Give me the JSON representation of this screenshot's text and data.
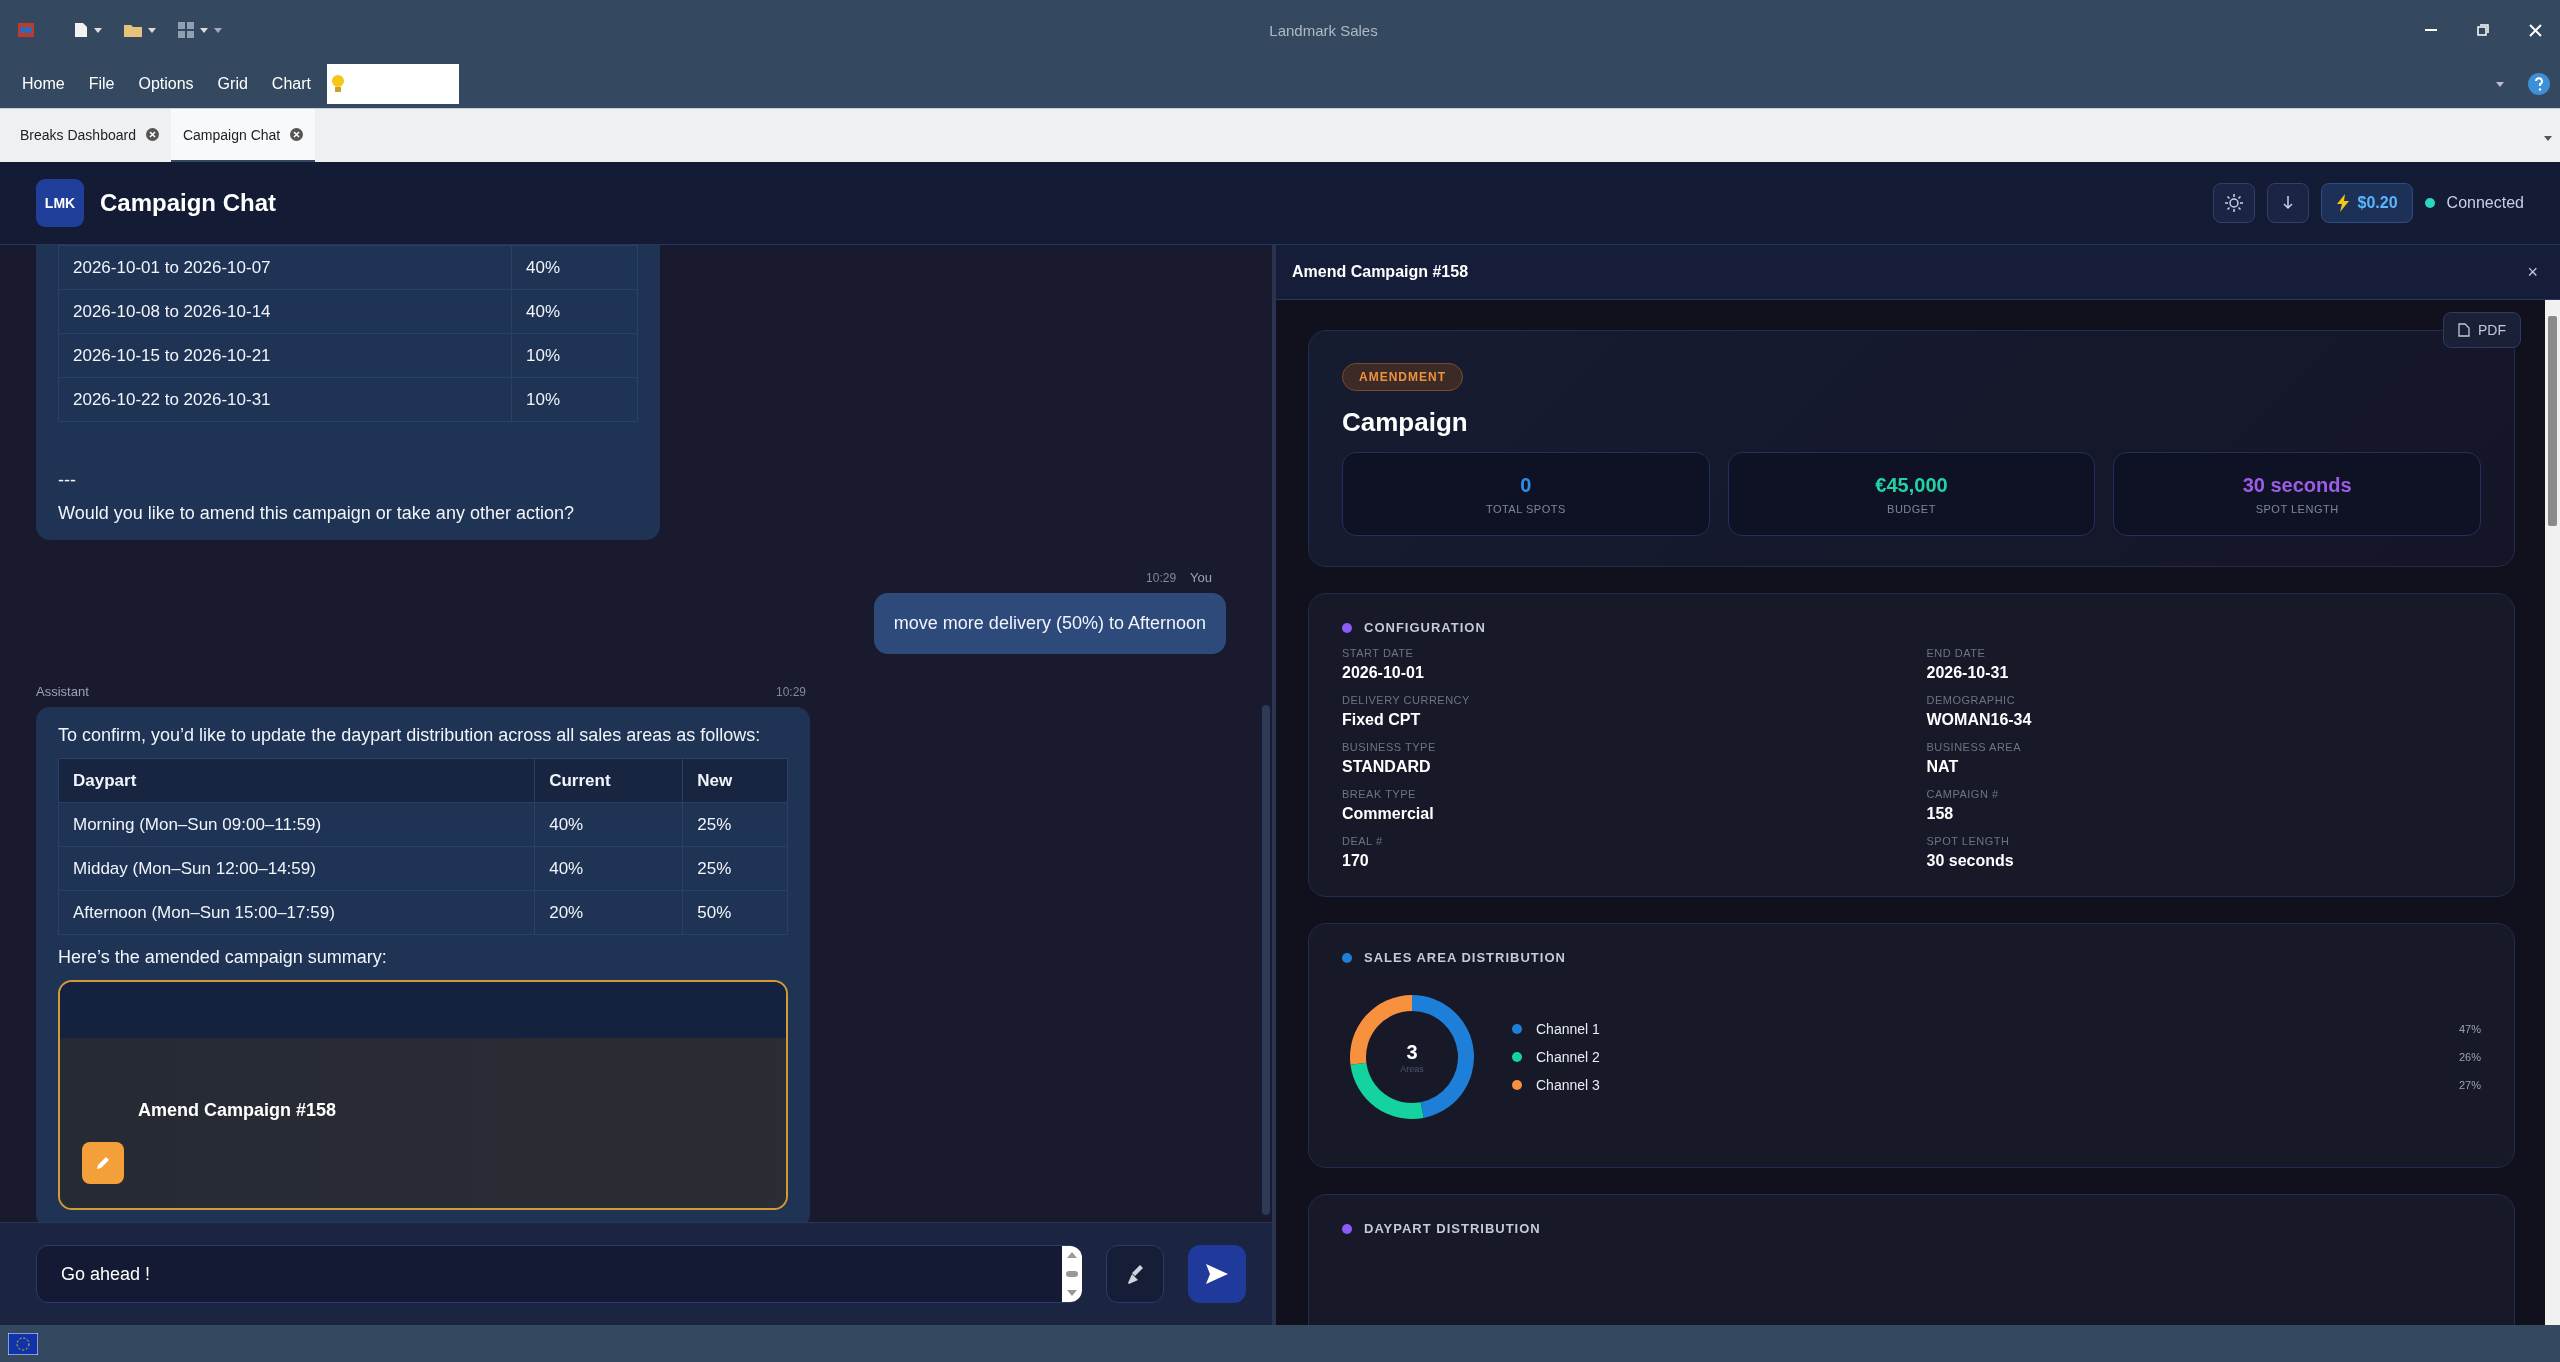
{
  "window": {
    "title": "Landmark Sales"
  },
  "menu": [
    "Home",
    "File",
    "Options",
    "Grid",
    "Chart"
  ],
  "doc_tabs": [
    {
      "label": "Breaks Dashboard",
      "selected": false
    },
    {
      "label": "Campaign Chat",
      "selected": true
    }
  ],
  "header": {
    "logo": "LMK",
    "title": "Campaign Chat",
    "cost": "$0.20",
    "status": "Connected"
  },
  "chat": {
    "messages": [
      {
        "kind": "assistant",
        "blocks": [
          {
            "kind": "table",
            "rows": [
              [
                "2026-10-01 to 2026-10-07",
                "40%"
              ],
              [
                "2026-10-08 to 2026-10-14",
                "40%"
              ],
              [
                "2026-10-15 to 2026-10-21",
                "10%"
              ],
              [
                "2026-10-22 to 2026-10-31",
                "10%"
              ]
            ]
          },
          {
            "kind": "text",
            "text": "---"
          },
          {
            "kind": "text",
            "text": "Would you like to amend this campaign or take any other action?"
          }
        ]
      },
      {
        "kind": "user",
        "time": "10:29",
        "sender": "You",
        "blocks": [
          {
            "kind": "text",
            "text": "move more delivery (50%) to Afternoon"
          }
        ]
      },
      {
        "kind": "assistant",
        "sender": "Assistant",
        "time": "10:29",
        "blocks": [
          {
            "kind": "text",
            "text": "To confirm, you’d like to update the daypart distribution across all sales areas as follows:"
          },
          {
            "kind": "table",
            "columns": [
              "Daypart",
              "Current",
              "New"
            ],
            "rows": [
              [
                "Morning (Mon–Sun 09:00–11:59)",
                "40%",
                "25%"
              ],
              [
                "Midday (Mon–Sun 12:00–14:59)",
                "40%",
                "25%"
              ],
              [
                "Afternoon (Mon–Sun 15:00–17:59)",
                "20%",
                "50%"
              ]
            ]
          },
          {
            "kind": "text",
            "text": "Here’s the amended campaign summary:"
          },
          {
            "kind": "card",
            "title": "Amend Campaign #158"
          }
        ]
      }
    ],
    "input": {
      "value": "Go ahead !"
    }
  },
  "panel": {
    "title": "Amend Campaign #158",
    "close": "×",
    "pdf": "PDF",
    "badge": "AMENDMENT",
    "heading": "Campaign",
    "stats": [
      {
        "value": "0",
        "label": "TOTAL SPOTS",
        "color": "#2f8de4"
      },
      {
        "value": "€45,000",
        "label": "BUDGET",
        "color": "#22d3a6"
      },
      {
        "value": "30 seconds",
        "label": "SPOT LENGTH",
        "color": "#9b5de5"
      }
    ],
    "sections": [
      {
        "kind": "fields",
        "title": "CONFIGURATION",
        "color": "#8b5cf6",
        "fields": [
          {
            "label": "START DATE",
            "value": "2026-10-01"
          },
          {
            "label": "END DATE",
            "value": "2026-10-31"
          },
          {
            "label": "DELIVERY CURRENCY",
            "value": "Fixed CPT"
          },
          {
            "label": "DEMOGRAPHIC",
            "value": "WOMAN16-34"
          },
          {
            "label": "BUSINESS TYPE",
            "value": "STANDARD"
          },
          {
            "label": "BUSINESS AREA",
            "value": "NAT"
          },
          {
            "label": "BREAK TYPE",
            "value": "Commercial"
          },
          {
            "label": "CAMPAIGN #",
            "value": "158"
          },
          {
            "label": "DEAL #",
            "value": "170"
          },
          {
            "label": "SPOT LENGTH",
            "value": "30 seconds"
          }
        ]
      },
      {
        "kind": "donut",
        "title": "SALES AREA DISTRIBUTION",
        "color": "#1e7fd8",
        "center": "3",
        "center_label": "Areas",
        "legend": [
          {
            "value": "47%",
            "color": "#1e7fd8"
          },
          {
            "value": "26%",
            "color": "#14d3a0"
          },
          {
            "value": "27%",
            "color": "#f7913d"
          }
        ],
        "chart_data": {
          "type": "donut",
          "categories": [
            "Channel 1",
            "Channel 2",
            "Channel 3"
          ],
          "values": [
            47,
            26,
            27
          ]
        }
      },
      {
        "kind": "heading",
        "title": "DAYPART DISTRIBUTION",
        "color": "#8b5cf6"
      }
    ]
  }
}
